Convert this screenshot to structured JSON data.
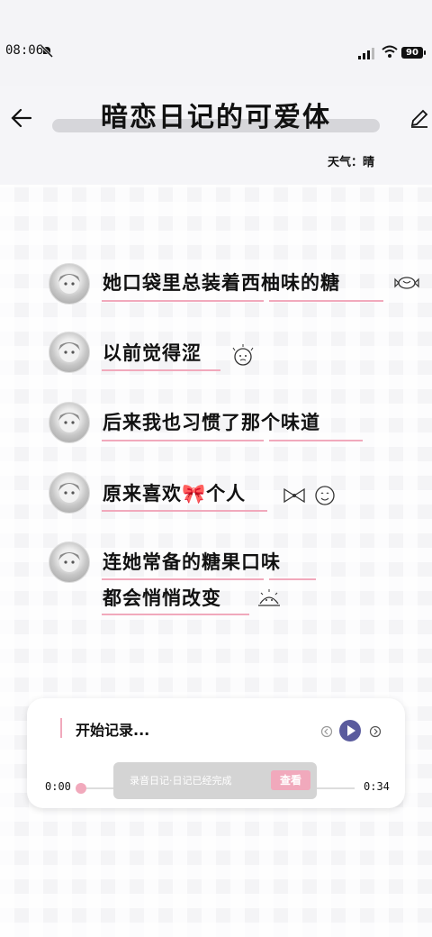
{
  "status": {
    "time": "08:06",
    "battery": "90"
  },
  "header": {
    "title": "暗恋日记的可爱体",
    "weather": "天气：晴"
  },
  "lines": [
    "她口袋里总装着西柚味的糖",
    "以前觉得涩",
    "后来我也习惯了那个味道",
    "原来喜欢🎀个人",
    "连她常备的糖果口味",
    "都会悄悄改变"
  ],
  "recorder": {
    "placeholder": "开始记录...",
    "time_start": "0:00",
    "time_end": "0:34",
    "toast": "录音日记·日记已经完成",
    "toast_button": "查看"
  }
}
